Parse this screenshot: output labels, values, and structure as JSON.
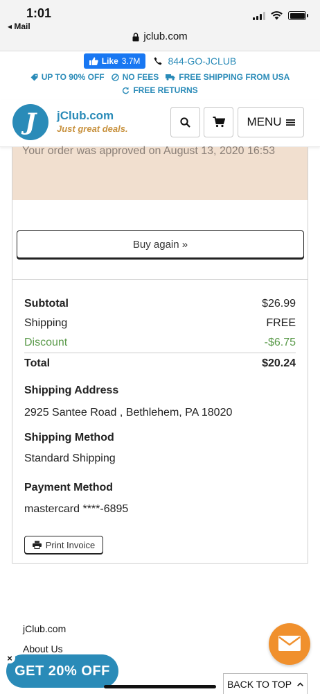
{
  "status_bar": {
    "time": "1:01",
    "back_app": "◂ Mail"
  },
  "browser": {
    "url": "jclub.com"
  },
  "promo": {
    "like_label": "Like",
    "like_count": "3.7M",
    "phone": "844-GO-JCLUB",
    "perks": [
      "UP TO 90% OFF",
      "NO FEES",
      "FREE SHIPPING FROM USA"
    ],
    "returns": "FREE RETURNS"
  },
  "nav": {
    "logo_letter": "J",
    "brand": "jClub.com",
    "tagline": "Just great deals.",
    "menu_label": "MENU"
  },
  "order": {
    "approved_text": "Your order was approved on August 13, 2020 16:53",
    "buy_again_label": "Buy again »",
    "summary": {
      "subtotal_label": "Subtotal",
      "subtotal_value": "$26.99",
      "shipping_label": "Shipping",
      "shipping_value": "FREE",
      "discount_label": "Discount",
      "discount_value": "-$6.75",
      "total_label": "Total",
      "total_value": "$20.24"
    },
    "shipping_address_title": "Shipping Address",
    "shipping_address": "2925 Santee Road , Bethlehem, PA 18020",
    "shipping_method_title": "Shipping Method",
    "shipping_method": "Standard Shipping",
    "payment_method_title": "Payment Method",
    "payment_method": "mastercard ****-6895",
    "print_label": "Print Invoice"
  },
  "footer": {
    "links": [
      "jClub.com",
      "About Us"
    ],
    "promo_pill": "GET 20% OFF",
    "close": "×",
    "back_to_top": "BACK TO TOP"
  },
  "colors": {
    "brand_blue": "#2a8bb8",
    "brand_gold": "#c8923f",
    "discount_green": "#5a9a4a",
    "banner_peach": "#f1dfcf",
    "chat_orange": "#f0902d",
    "facebook_blue": "#1877f2"
  }
}
